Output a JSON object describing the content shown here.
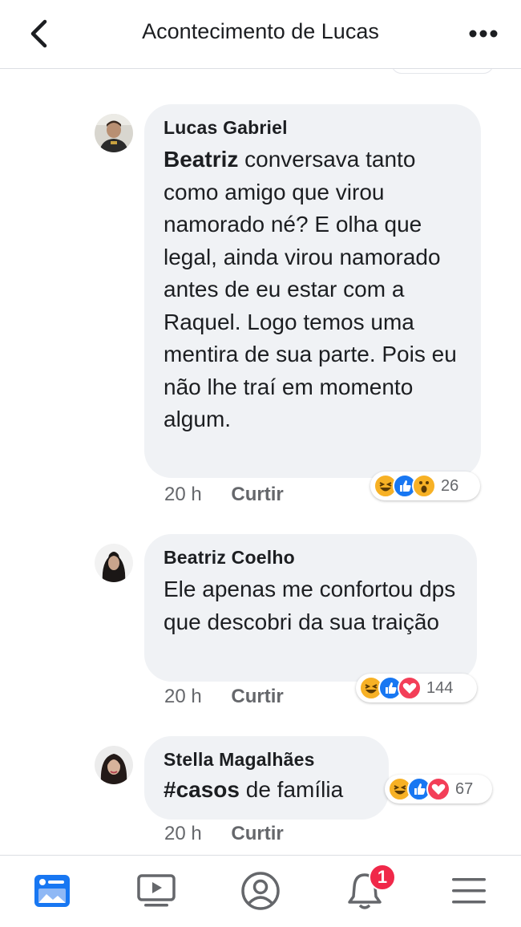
{
  "header": {
    "title": "Acontecimento de Lucas"
  },
  "comments": [
    {
      "author": "Lucas Gabriel",
      "mention": "Beatriz",
      "text": " conversava tanto como amigo que virou namorado né? E olha que legal, ainda virou namorado antes de eu estar com a Raquel. Logo temos uma mentira de sua parte. Pois eu não lhe traí em momento algum.",
      "time": "20 h",
      "like_label": "Curtir",
      "reactions": [
        "haha",
        "like",
        "wow"
      ],
      "reaction_count": "26"
    },
    {
      "author": "Beatriz Coelho",
      "text": "Ele apenas me confortou dps que descobri da sua traição",
      "time": "20 h",
      "like_label": "Curtir",
      "reactions": [
        "haha",
        "like",
        "love"
      ],
      "reaction_count": "144"
    },
    {
      "author": "Stella Magalhães",
      "hashtag": "#casos",
      "text": " de família",
      "time": "20 h",
      "like_label": "Curtir",
      "reactions": [
        "haha",
        "like",
        "love"
      ],
      "reaction_count": "67"
    }
  ],
  "bottom_nav": {
    "notification_badge": "1",
    "tabs": [
      "news-feed",
      "watch",
      "profile",
      "notifications",
      "menu"
    ]
  },
  "colors": {
    "accent": "#1877f2",
    "bubble": "#f0f2f5",
    "badge": "#f02849",
    "muted": "#65676b"
  }
}
